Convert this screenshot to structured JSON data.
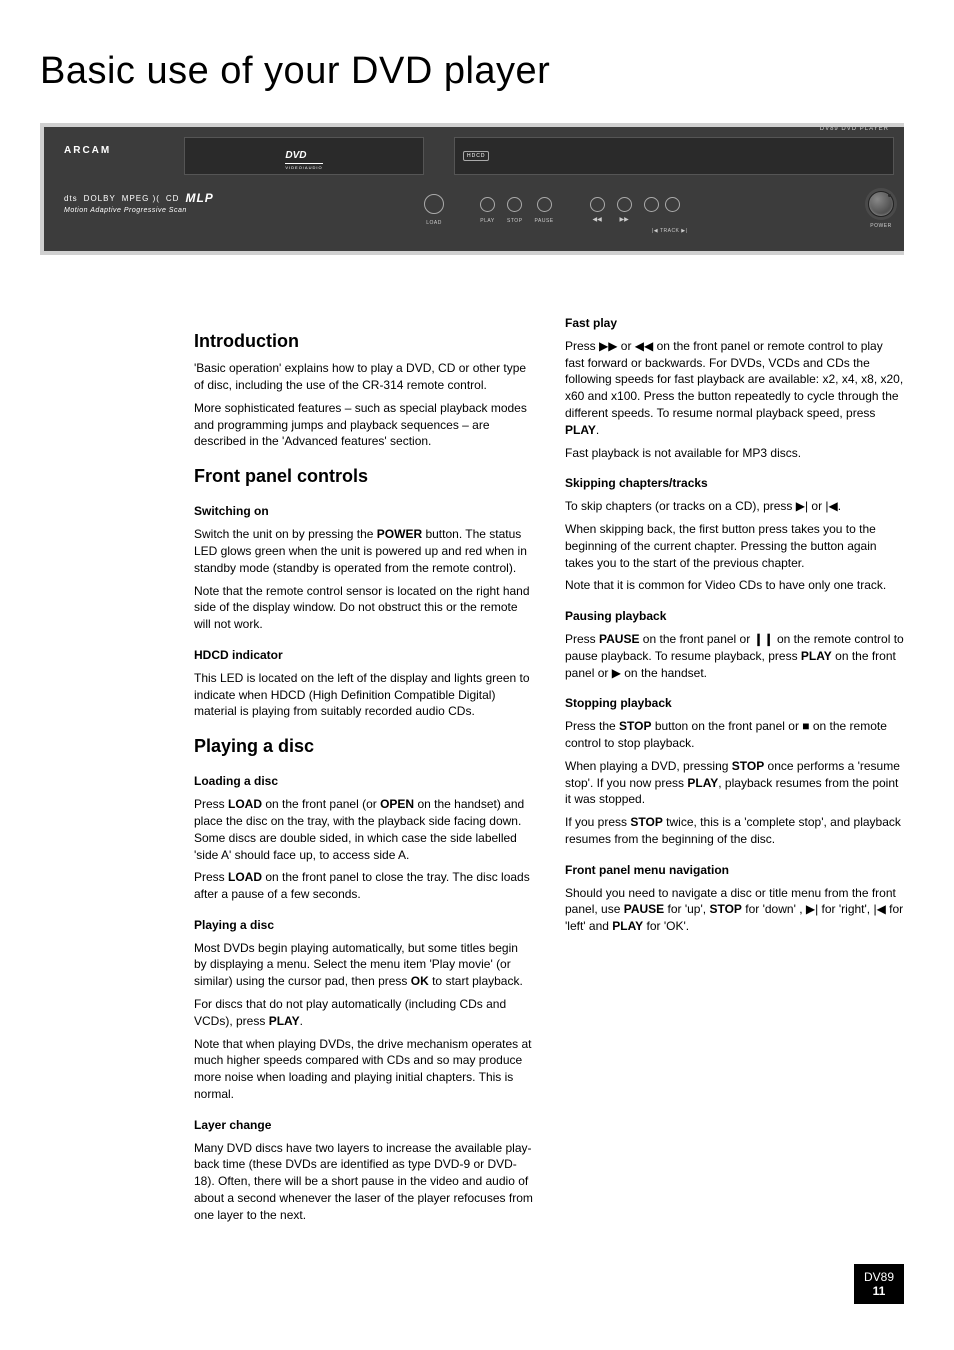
{
  "page_title": "Basic use of your DVD player",
  "panel": {
    "brand": "ARCAM",
    "dvd_logo": "DVD",
    "dvd_sub": "VIDEO/AUDIO",
    "hdcd": "HDCD",
    "model": "DV89 DVD PLAYER",
    "badges": {
      "dts": "dts",
      "dd": "DOLBY",
      "mpeg": "MPEG )(",
      "misc": "CD",
      "mlp": "MLP"
    },
    "maps": "Motion Adaptive Progressive Scan",
    "buttons": {
      "load": "LOAD",
      "play": "PLAY",
      "stop": "STOP",
      "pause": "PAUSE",
      "rew": "◀◀",
      "fwd": "▶▶",
      "track": "|◀  TRACK  ▶|",
      "power": "POWER"
    }
  },
  "intro": {
    "h": "Introduction",
    "p1": "'Basic operation' explains how to play a DVD, CD or other type of disc, including the use of the CR-314 remote control.",
    "p2": "More sophisticated features – such as special playback modes and programming jumps and playback sequences – are described in the 'Advanced features' section."
  },
  "fpc": {
    "h": "Front panel controls",
    "switching_on": {
      "h": "Switching on",
      "p1a": "Switch the unit on by pressing the ",
      "p1b": " button. The status LED glows green when the unit is powered up and red when in standby mode (standby is operated from the remote control).",
      "power": "POWER",
      "p2": "Note that the remote control sensor is located on the right hand side of the display window. Do not obstruct this or the remote will not work."
    },
    "hdcd": {
      "h": "HDCD indicator",
      "p": "This LED is located on the left of the display and lights green to indicate when HDCD (High Definition Compatible Digital) material is playing from suitably recorded audio CDs."
    }
  },
  "play": {
    "h": "Playing a disc",
    "loading": {
      "h": "Loading a disc",
      "p1a": "Press ",
      "load": "LOAD",
      "p1b": " on the front panel (or ",
      "open": "OPEN",
      "p1c": " on the handset) and place the disc on the tray, with the playback side facing down. Some discs are double sided, in which case the side labelled 'side A' should face up, to access side A.",
      "p2a": "Press ",
      "p2b": " on the front panel to close the tray. The disc loads after a pause of a few seconds."
    },
    "playing": {
      "h": "Playing a disc",
      "p1a": "Most DVDs begin playing automatically, but some titles begin by displaying a menu. Select the menu item 'Play movie' (or similar) using the cursor pad, then press ",
      "ok": "OK",
      "p1b": " to start playback.",
      "p2a": "For discs that do not play automatically (including CDs and VCDs), press ",
      "playw": "PLAY",
      "p2b": ".",
      "p3": "Note that when playing DVDs, the drive mechanism operates at much higher speeds compared with CDs and so may produce more noise when loading and playing initial chapters. This is normal."
    },
    "layer": {
      "h": "Layer change",
      "p": "Many DVD discs have two layers to increase the available play-back time (these DVDs are identified as type DVD-9 or DVD-18). Often, there will be a short pause in the video and audio of about a second whenever the laser of the player refocuses from one layer to the next."
    }
  },
  "col2": {
    "fast": {
      "h": "Fast play",
      "p1a": "Press ▶▶ or ◀◀ on the front panel or remote control to play fast forward or backwards. For DVDs, VCDs and CDs the following speeds for fast playback are available: x2, x4, x8, x20, x60 and x100. Press the button repeatedly to cycle through the different speeds. To resume normal playback speed, press ",
      "playw": "PLAY",
      "p1b": ".",
      "p2": "Fast playback is not available for MP3 discs."
    },
    "skip": {
      "h": "Skipping chapters/tracks",
      "p1": "To skip chapters (or tracks on a CD), press ▶| or |◀.",
      "p2": "When skipping back, the first button press takes you to the beginning of the current chapter. Pressing the button again takes you to the start of the previous chapter.",
      "p3": "Note that it is common for Video CDs to have only one track."
    },
    "pause": {
      "h": "Pausing playback",
      "p1a": "Press ",
      "pausew": "PAUSE",
      "p1b": " on the front panel or ",
      "sym": "❙❙",
      "p1c": " on the remote control to pause playback. To resume playback, press ",
      "playw": "PLAY",
      "p1d": " on the front panel or ▶ on the handset."
    },
    "stop": {
      "h": "Stopping playback",
      "p1a": "Press the ",
      "stopw": "STOP",
      "p1b": " button on the front panel or ■ on the remote control to stop playback.",
      "p2a": "When playing a DVD, pressing ",
      "p2b": " once performs a 'resume stop'. If you now press ",
      "playw": "PLAY",
      "p2c": ", playback resumes from the point it was stopped.",
      "p3a": "If you press ",
      "p3b": " twice, this is a 'complete stop', and playback resumes from the beginning of the disc."
    },
    "menu": {
      "h": "Front panel menu navigation",
      "p1a": "Should you need to navigate a disc or title menu from the front panel, use ",
      "pausew": "PAUSE",
      "p1b": " for 'up', ",
      "stopw": "STOP",
      "p1c": " for 'down' , ▶| for 'right', |◀ for 'left' and ",
      "playw": "PLAY",
      "p1d": " for 'OK'."
    }
  },
  "footer": {
    "model": "DV89",
    "page": "11"
  }
}
